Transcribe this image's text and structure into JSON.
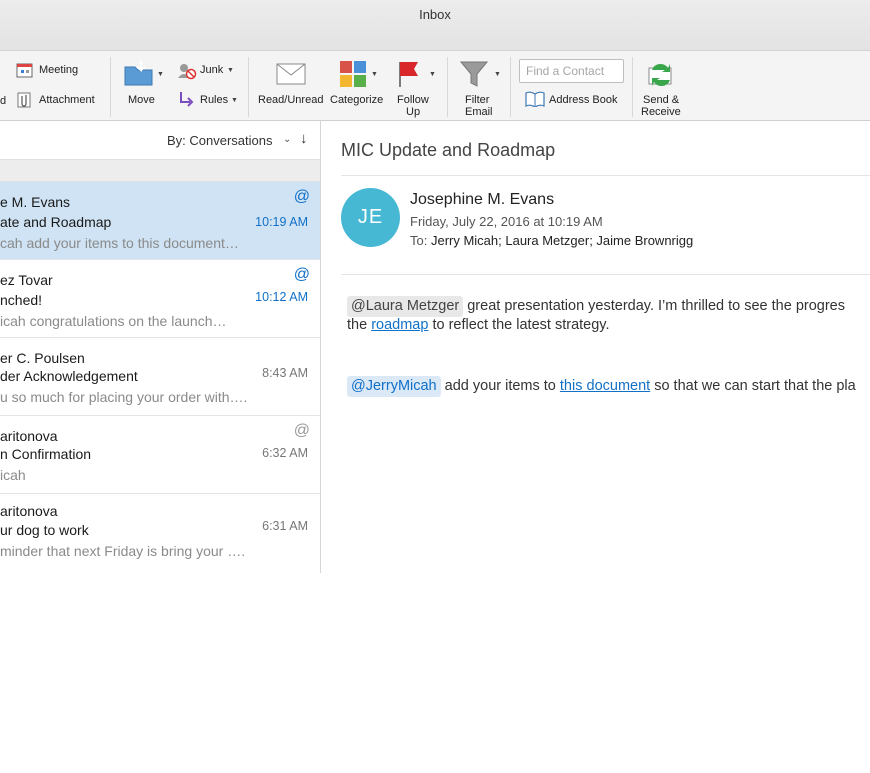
{
  "window": {
    "title": "Inbox"
  },
  "ribbon": {
    "partial_left_label": "d",
    "meeting": "Meeting",
    "attachment": "Attachment",
    "move": "Move",
    "junk": "Junk",
    "rules": "Rules",
    "read_unread": "Read/Unread",
    "categorize": "Categorize",
    "follow_up_line1": "Follow",
    "follow_up_line2": "Up",
    "filter_line1": "Filter",
    "filter_line2": "Email",
    "find_contact_placeholder": "Find a Contact",
    "address_book": "Address Book",
    "send_receive_line1": "Send &",
    "send_receive_line2": "Receive"
  },
  "colors": {
    "accent": "#1170c7",
    "avatar": "#47b8d4",
    "selected_row": "#cfe3f4",
    "flag": "#d9262b"
  },
  "list": {
    "sort_label": "By: Conversations",
    "sort_chevron": "⌄",
    "sort_arrow": "↓",
    "messages": [
      {
        "sender": "e M. Evans",
        "subject": "ate and Roadmap",
        "preview": "cah add your items to this document…",
        "time": "10:19 AM",
        "at": "@"
      },
      {
        "sender": "ez Tovar",
        "subject": "nched!",
        "preview": "icah congratulations on the launch…",
        "time": "10:12 AM",
        "at": "@"
      },
      {
        "sender": "er C. Poulsen",
        "subject": "der Acknowledgement",
        "preview": "u so much for placing your order with….",
        "time": "8:43 AM"
      },
      {
        "sender": "aritonova",
        "subject": "n Confirmation",
        "preview": "icah",
        "time": "6:32 AM",
        "at": "@"
      },
      {
        "sender": "aritonova",
        "subject": "ur dog to work",
        "preview": "minder that next Friday is bring your ….",
        "time": "6:31 AM"
      }
    ]
  },
  "reading": {
    "subject": "MIC Update and Roadmap",
    "avatar_initials": "JE",
    "from_name": "Josephine M. Evans",
    "date": "Friday, July 22, 2016 at 10:19 AM",
    "to_label": "To:",
    "to_recipients": "Jerry Micah; Laura Metzger; Jaime Brownrigg",
    "body": {
      "p1_mention": "@Laura Metzger",
      "p1_text_a": " great presentation yesterday. I’m thrilled to see the progres",
      "p1_line2_a": "the ",
      "p1_link": "roadmap",
      "p1_line2_b": " to reflect the latest strategy.",
      "p2_mention": "@JerryMicah",
      "p2_text_a": " add your items to ",
      "p2_link": "this document",
      "p2_text_b": " so that we can start that the pla"
    }
  }
}
